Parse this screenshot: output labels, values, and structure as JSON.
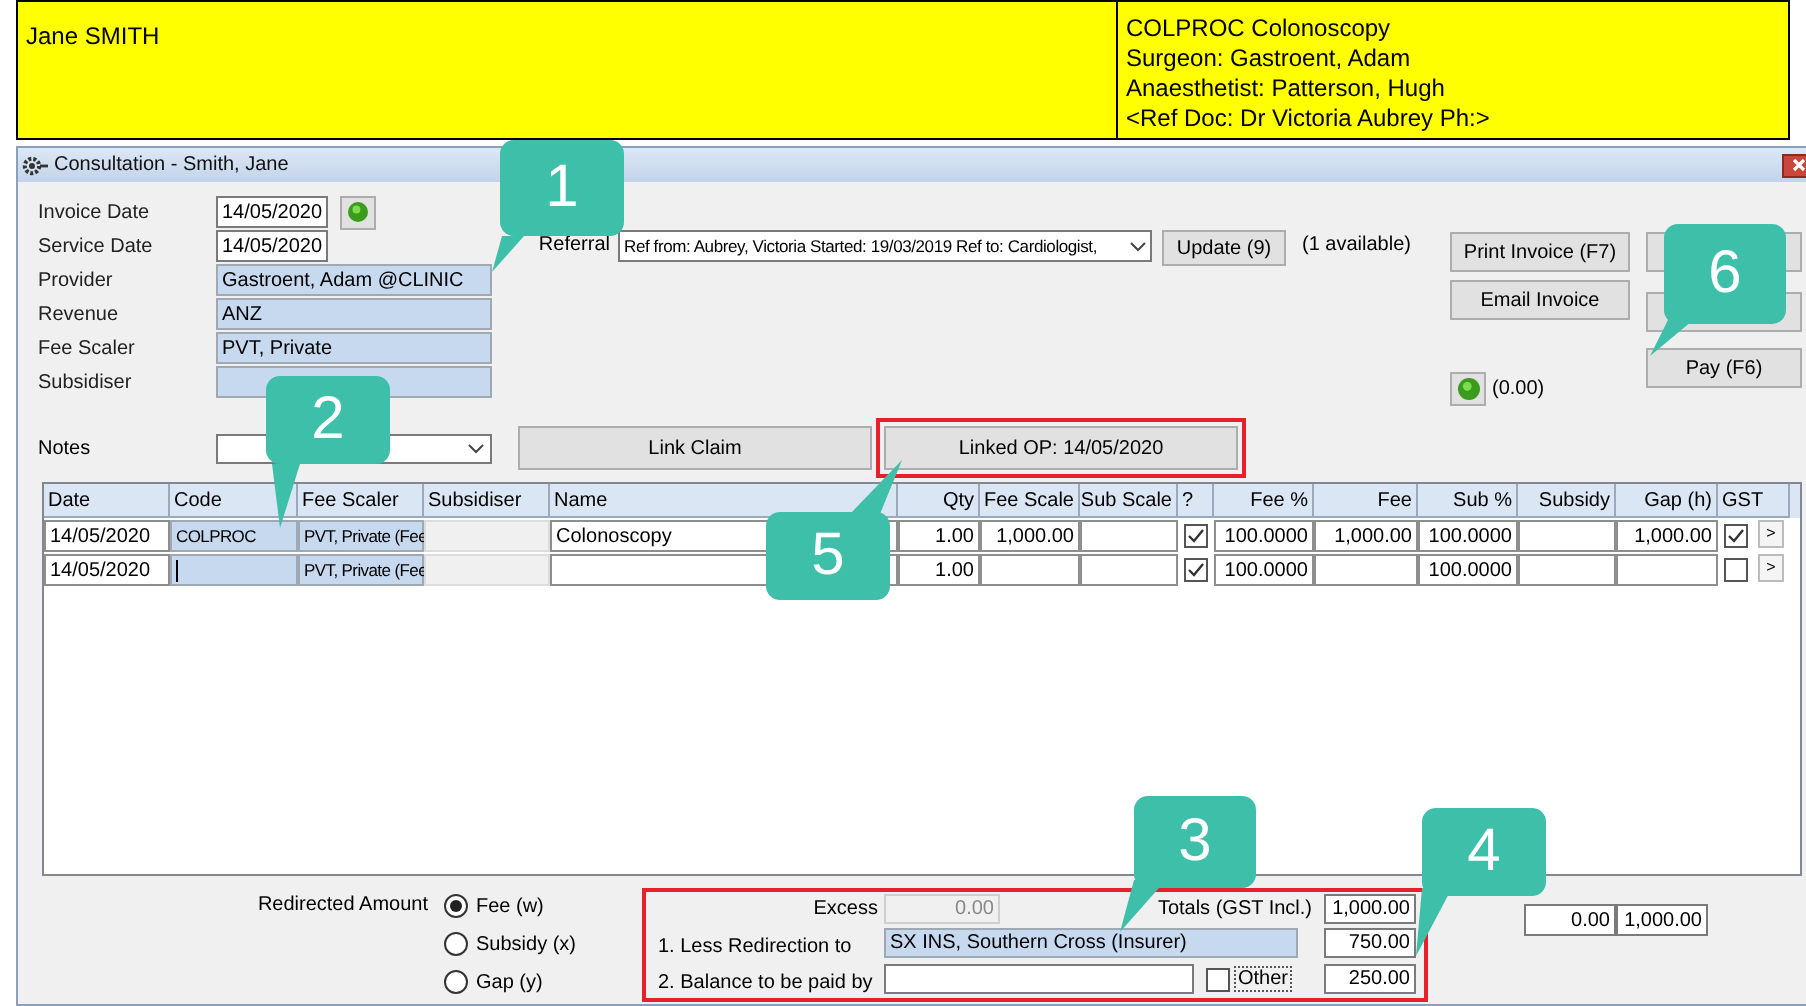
{
  "header": {
    "patient": "Jane SMITH",
    "lines": [
      "COLPROC Colonoscopy",
      "Surgeon: Gastroent, Adam",
      "Anaesthetist: Patterson, Hugh",
      "<Ref Doc: Dr Victoria Aubrey Ph:>"
    ]
  },
  "window": {
    "title": "Consultation - Smith, Jane"
  },
  "fields": [
    {
      "label": "Invoice Date",
      "value": "14/05/2020",
      "kind": "date",
      "info": true
    },
    {
      "label": "Service Date",
      "value": "14/05/2020",
      "kind": "date",
      "info": false
    },
    {
      "label": "Provider",
      "value": "Gastroent, Adam @CLINIC",
      "kind": "lookup",
      "info": false
    },
    {
      "label": "Revenue",
      "value": "ANZ",
      "kind": "lookup",
      "info": false
    },
    {
      "label": "Fee Scaler",
      "value": "PVT, Private",
      "kind": "lookup",
      "info": false
    },
    {
      "label": "Subsidiser",
      "kind": "lookup",
      "info": false
    }
  ],
  "referral": {
    "label": "Referral",
    "value": "Ref from: Aubrey, Victoria Started: 19/03/2019 Ref to: Cardiologist,",
    "update": "Update (9)",
    "available": "(1 available)"
  },
  "actions": [
    "Print Invoice (F7)",
    "Email Invoice"
  ],
  "pay_button": "Pay (F6)",
  "balance": "(0.00)",
  "notes": {
    "label": "Notes"
  },
  "link_claim": "Link Claim",
  "linked_op": {
    "label": "Linked OP: 14/05/2020",
    "highlighted": true
  },
  "table": {
    "columns": [
      {
        "label": "Date",
        "kind": "text"
      },
      {
        "label": "Code",
        "kind": "lookup"
      },
      {
        "label": "Fee Scaler",
        "kind": "lookup"
      },
      {
        "label": "Subsidiser",
        "kind": "readonly"
      },
      {
        "label": "Name",
        "kind": "text"
      },
      {
        "label": "Qty",
        "kind": "number"
      },
      {
        "label": "Fee Scale",
        "kind": "number"
      },
      {
        "label": "Sub Scale",
        "kind": "number"
      },
      {
        "label": "?",
        "kind": "check"
      },
      {
        "label": "Fee %",
        "kind": "number"
      },
      {
        "label": "Fee",
        "kind": "number"
      },
      {
        "label": "Sub %",
        "kind": "number"
      },
      {
        "label": "Subsidy",
        "kind": "number"
      },
      {
        "label": "Gap (h)",
        "kind": "number"
      },
      {
        "label": "GST",
        "kind": "check"
      }
    ],
    "rows": [
      {
        "cells": [
          "14/05/2020",
          "COLPROC",
          "PVT, Private (Fee",
          null,
          "Colonoscopy",
          "1.00",
          "1,000.00",
          null,
          true,
          "100.0000",
          "1,000.00",
          "100.0000",
          null,
          "1,000.00",
          true
        ],
        "editing": false,
        "more": ">"
      },
      {
        "cells": [
          "14/05/2020",
          null,
          "PVT, Private (Fee",
          null,
          null,
          "1.00",
          null,
          null,
          true,
          "100.0000",
          null,
          "100.0000",
          null,
          null,
          false
        ],
        "editing": true,
        "more": ">"
      }
    ]
  },
  "redirect": {
    "label": "Redirected Amount",
    "options": [
      {
        "label": "Fee (w)",
        "selected": true
      },
      {
        "label": "Subsidy (x)",
        "selected": false
      },
      {
        "label": "Gap (y)",
        "selected": false
      }
    ]
  },
  "payment": {
    "highlighted": true,
    "excess": {
      "label": "Excess",
      "value": "0.00",
      "disabled": true
    },
    "totals": {
      "label": "Totals (GST Incl.)",
      "value": "1,000.00"
    },
    "redirection": {
      "label": "1. Less Redirection to",
      "payer": "SX INS, Southern Cross (Insurer)",
      "value": "750.00"
    },
    "remainder": {
      "label": "2. Balance to be paid by",
      "other": {
        "label": "Other",
        "checked": false
      },
      "value": "250.00"
    }
  },
  "summary": [
    "0.00",
    "1,000.00"
  ],
  "callouts": [
    "1",
    "2",
    "3",
    "4",
    "5",
    "6"
  ]
}
